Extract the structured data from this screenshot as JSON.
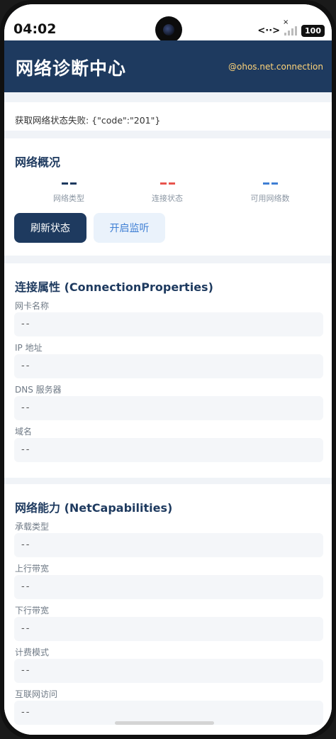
{
  "status_bar": {
    "time": "04:02",
    "battery": "100",
    "network_glyph": "<··>",
    "x_mark": "×"
  },
  "header": {
    "title": "网络诊断中心",
    "tag": "@ohos.net.connection"
  },
  "error_text": "获取网络状态失败: {\"code\":\"201\"}",
  "overview": {
    "title": "网络概况",
    "stats": [
      {
        "label": "网络类型",
        "color": "#1e3a5f"
      },
      {
        "label": "连接状态",
        "color": "#e8544e"
      },
      {
        "label": "可用网络数",
        "color": "#3f7fd4"
      }
    ],
    "refresh_button": "刷新状态",
    "listen_button": "开启监听"
  },
  "connection_properties": {
    "title": "连接属性 (ConnectionProperties)",
    "fields": [
      {
        "label": "网卡名称",
        "value": "--"
      },
      {
        "label": "IP 地址",
        "value": "--"
      },
      {
        "label": "DNS 服务器",
        "value": "--"
      },
      {
        "label": "域名",
        "value": "--"
      }
    ]
  },
  "net_capabilities": {
    "title": "网络能力 (NetCapabilities)",
    "fields": [
      {
        "label": "承载类型",
        "value": "--"
      },
      {
        "label": "上行带宽",
        "value": "--"
      },
      {
        "label": "下行带宽",
        "value": "--"
      },
      {
        "label": "计费模式",
        "value": "--"
      },
      {
        "label": "互联网访问",
        "value": "--"
      }
    ]
  }
}
